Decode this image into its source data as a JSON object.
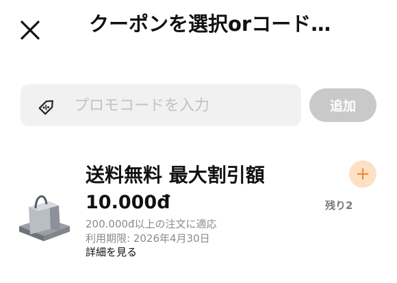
{
  "header": {
    "title": "クーポンを選択orコード…",
    "close_icon": "close-icon"
  },
  "promo": {
    "placeholder": "プロモコードを入力",
    "value": "",
    "icon": "tag-icon",
    "add_label": "追加"
  },
  "coupon": {
    "title": "送料無料 最大割引額",
    "amount": "10.000đ",
    "condition": "200.000đ以上の注文に適応",
    "expiry": "利用期限: 2026年4月30日",
    "details_label": "詳細を見る",
    "remaining": "残り2",
    "icon": "shopping-bag-icon",
    "add_icon": "plus-icon"
  },
  "colors": {
    "accent": "#f08a2a",
    "accent_bg": "#fde0c6",
    "input_bg": "#f1f1f1",
    "button_disabled": "#c9c9c9"
  }
}
